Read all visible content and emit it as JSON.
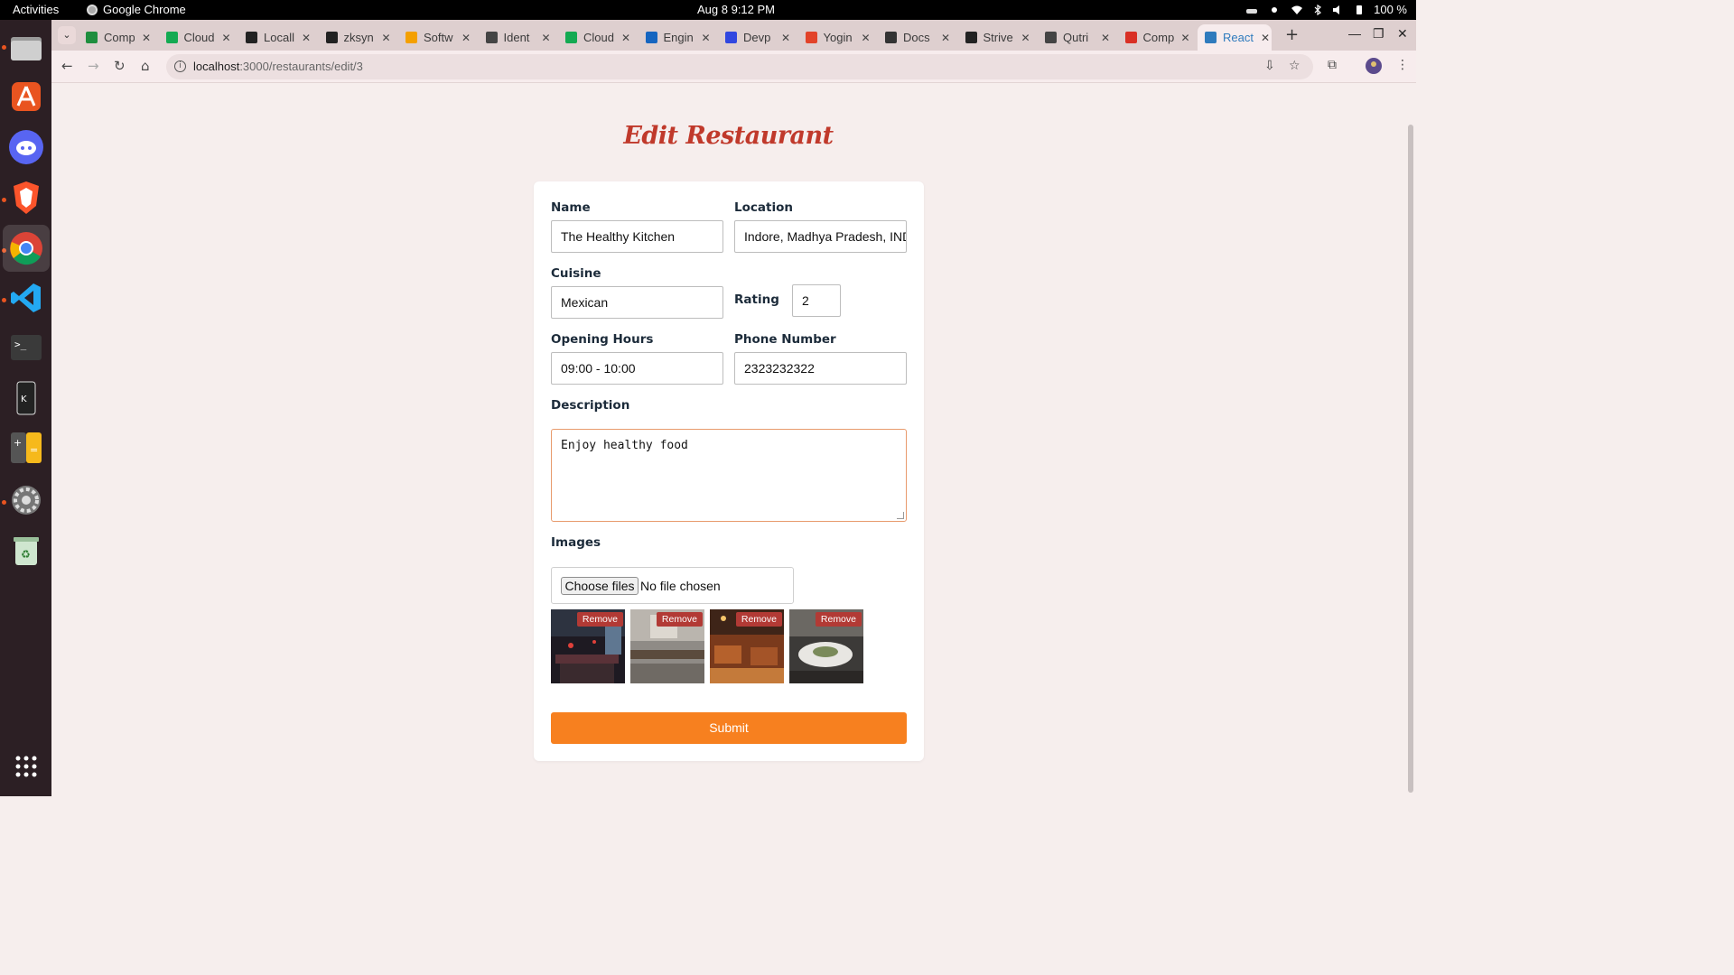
{
  "system": {
    "activities": "Activities",
    "app_name": "Google Chrome",
    "clock": "Aug 8  9:12 PM",
    "battery": "100 %"
  },
  "browser": {
    "tabs": [
      {
        "label": "Comp",
        "color": "#1e8e3e"
      },
      {
        "label": "Cloud",
        "color": "#13aa52"
      },
      {
        "label": "Locall",
        "color": "#222222"
      },
      {
        "label": "zksyn",
        "color": "#222222"
      },
      {
        "label": "Softw",
        "color": "#f4a000"
      },
      {
        "label": "Ident",
        "color": "#444444"
      },
      {
        "label": "Cloud",
        "color": "#13aa52"
      },
      {
        "label": "Engin",
        "color": "#1565c0"
      },
      {
        "label": "Devp",
        "color": "#3047e0"
      },
      {
        "label": "Yogin",
        "color": "#e24329"
      },
      {
        "label": "Docs",
        "color": "#333333"
      },
      {
        "label": "Strive",
        "color": "#222222"
      },
      {
        "label": "Qutri",
        "color": "#444444"
      },
      {
        "label": "Comp",
        "color": "#d93025"
      },
      {
        "label": "React",
        "color": "#2f7bbd",
        "active": true
      }
    ],
    "url_host": "localhost",
    "url_path": ":3000/restaurants/edit/3"
  },
  "page": {
    "title": "Edit Restaurant",
    "form": {
      "name_label": "Name",
      "name_value": "The Healthy Kitchen",
      "location_label": "Location",
      "location_value": "Indore, Madhya Pradesh, IND",
      "cuisine_label": "Cuisine",
      "cuisine_value": "Mexican",
      "rating_label": "Rating",
      "rating_value": "2",
      "hours_label": "Opening Hours",
      "hours_value": "09:00 - 10:00",
      "phone_label": "Phone Number",
      "phone_value": "2323232322",
      "description_label": "Description",
      "description_value": "Enjoy healthy food",
      "images_label": "Images",
      "choose_files": "Choose files",
      "no_file": "No file chosen",
      "remove_label": "Remove",
      "submit_label": "Submit"
    }
  },
  "colors": {
    "accent": "#f7801f",
    "title": "#c0392b",
    "remove": "#b23a35"
  }
}
